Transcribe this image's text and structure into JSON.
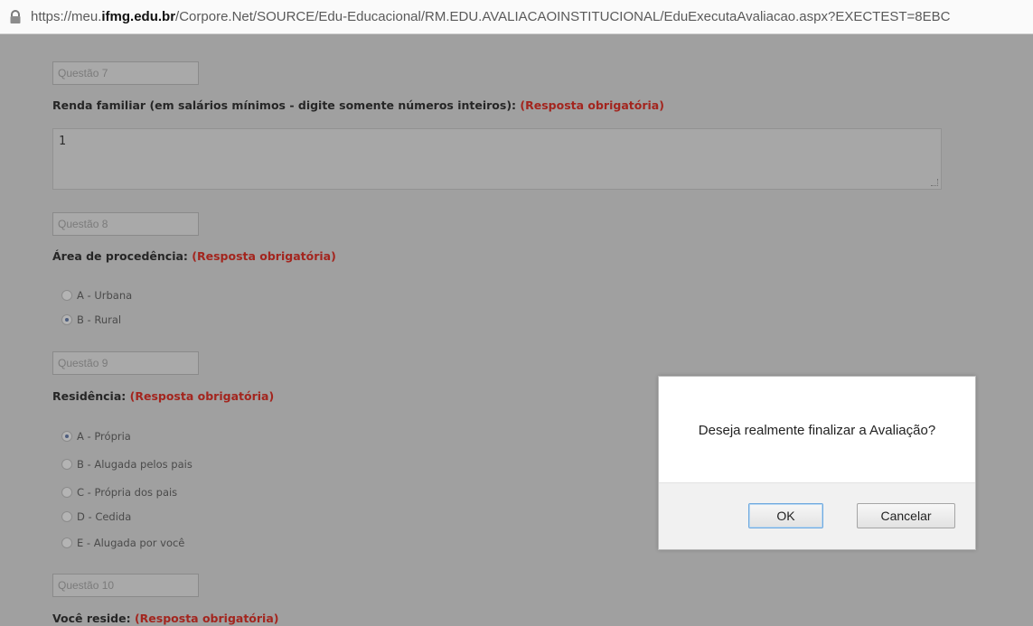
{
  "browser": {
    "url_prefix": "https://meu.",
    "url_host": "ifmg.edu.br",
    "url_path": "/Corpore.Net/SOURCE/Edu-Educacional/RM.EDU.AVALIACAOINSTITUCIONAL/EduExecutaAvaliacao.aspx?EXECTEST=8EBC"
  },
  "questions": [
    {
      "number": "Questão 7",
      "title": "Renda familiar (em salários mínimos - digite somente números inteiros): ",
      "required": "(Resposta obrigatória)",
      "answer": "1"
    },
    {
      "number": "Questão 8",
      "title": "Área de procedência: ",
      "required": "(Resposta obrigatória)",
      "options": [
        "A - Urbana",
        "B - Rural"
      ],
      "selected": "B - Rural"
    },
    {
      "number": "Questão 9",
      "title": "Residência: ",
      "required": "(Resposta obrigatória)",
      "options": [
        "A - Própria",
        "B - Alugada pelos pais",
        "C - Própria dos pais",
        "D - Cedida",
        "E - Alugada por você"
      ],
      "selected": "A - Própria"
    },
    {
      "number": "Questão 10",
      "title": "Você reside: ",
      "required": "(Resposta obrigatória)"
    }
  ],
  "dialog": {
    "message": "Deseja realmente finalizar a Avaliação?",
    "ok_label": "OK",
    "cancel_label": "Cancelar"
  },
  "icons": {
    "lock": "lock-icon"
  },
  "colors": {
    "required_text": "#a3251e",
    "overlay": "#a0a0a0",
    "dialog_bg": "#ffffff"
  }
}
